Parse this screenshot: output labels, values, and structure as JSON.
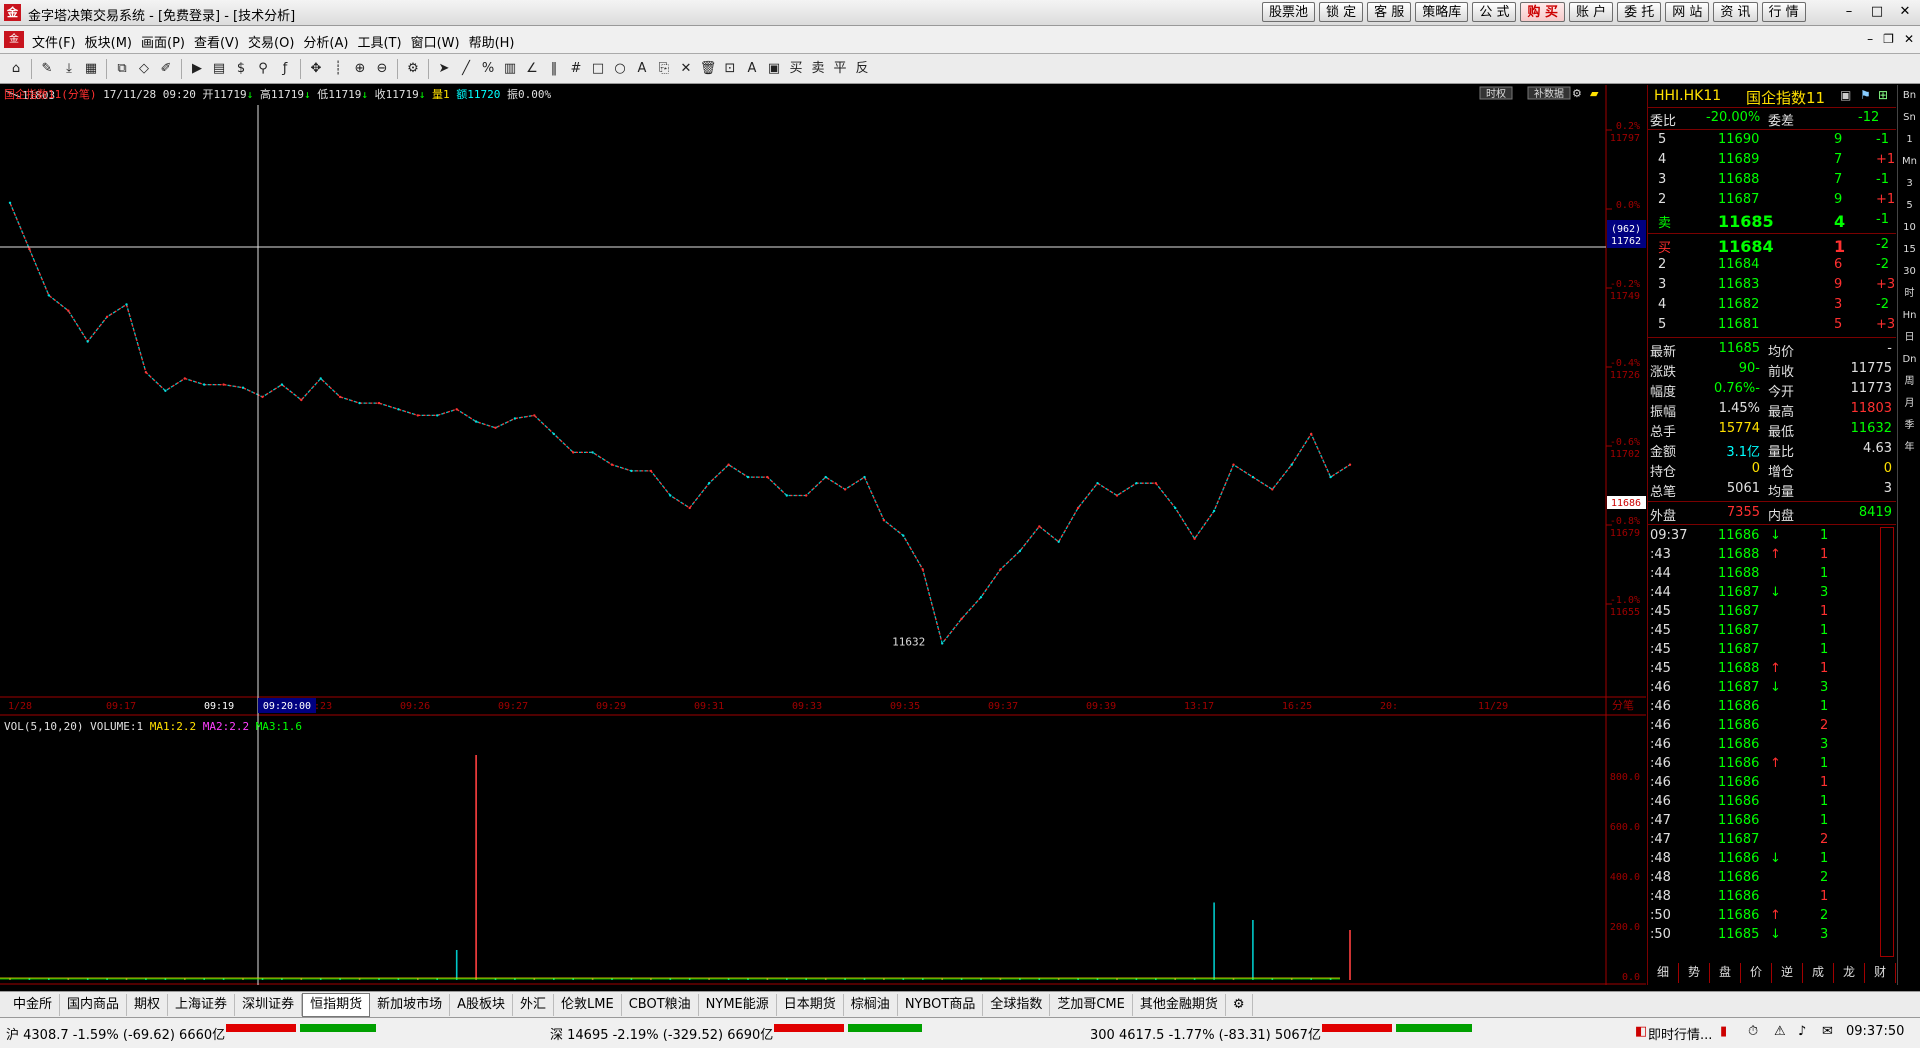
{
  "window": {
    "title": "金字塔决策交易系统 - [免费登录] - [技术分析]",
    "app_icon": "app-logo-icon"
  },
  "top_buttons": [
    {
      "label": "股票池"
    },
    {
      "label": "锁 定"
    },
    {
      "label": "客 服"
    },
    {
      "label": "策略库"
    },
    {
      "label": "公 式"
    },
    {
      "label": "购 买",
      "highlight": true
    },
    {
      "label": "账 户"
    },
    {
      "label": "委 托"
    },
    {
      "label": "网 站"
    },
    {
      "label": "资 讯"
    },
    {
      "label": "行 情"
    }
  ],
  "menu": [
    "文件(F)",
    "板块(M)",
    "画面(P)",
    "查看(V)",
    "交易(O)",
    "分析(A)",
    "工具(T)",
    "窗口(W)",
    "帮助(H)"
  ],
  "chart": {
    "info": {
      "symbol": "国企指数11(分笔)",
      "date": "17/11/28",
      "time": "09:20",
      "open": "开11719",
      "high": "高11719",
      "low": "低11719",
      "close": "收11719",
      "qty": "量1",
      "amount": "额11720",
      "amp": "振0.00%"
    },
    "badges": [
      "时权",
      "补数据"
    ],
    "max_label": "11803",
    "min_label": "11632",
    "cursor_time": "09:20:00",
    "cursor_price": "11762",
    "cursor_count": "(962)",
    "last_price_tag": "11686",
    "time_axis": [
      "1/28",
      "09:17",
      "09:19",
      "09:23",
      "09:26",
      "09:27",
      "09:29",
      "09:31",
      "09:33",
      "09:35",
      "09:37",
      "09:39",
      "13:17",
      "16:25",
      "20:",
      "11/29"
    ],
    "time_axis_right": "分笔",
    "price_ticks": [
      {
        "pct": "0.2%",
        "price": "11797"
      },
      {
        "pct": "0.0%",
        "price": ""
      },
      {
        "pct": "-0.2%",
        "price": "11749"
      },
      {
        "pct": "-0.4%",
        "price": "11726"
      },
      {
        "pct": "-0.6%",
        "price": "11702"
      },
      {
        "pct": "-0.8%",
        "price": "11679"
      },
      {
        "pct": "-1.0%",
        "price": "11655"
      }
    ],
    "volume": {
      "title": "VOL(5,10,20)",
      "label": "VOLUME:1",
      "ma1": "MA1:2.2",
      "ma2": "MA2:2.2",
      "ma3": "MA3:1.6",
      "ticks": [
        "800.0",
        "600.0",
        "400.0",
        "200.0",
        "0.0"
      ]
    }
  },
  "chart_data": {
    "type": "line",
    "title": "国企指数11(分笔)",
    "y_range": [
      11625,
      11810
    ],
    "x": [
      0,
      1,
      2,
      3,
      4,
      5,
      6,
      7,
      8,
      9,
      10,
      11,
      12,
      13,
      14,
      15,
      16,
      17,
      18,
      19,
      20,
      21,
      22,
      23,
      24,
      25,
      26,
      27,
      28,
      29,
      30,
      31,
      32,
      33,
      34,
      35,
      36,
      37,
      38,
      39,
      40,
      41,
      42,
      43,
      44,
      45,
      46,
      47,
      48,
      49,
      50,
      51,
      52,
      53,
      54,
      55,
      56,
      57,
      58,
      59,
      60,
      61,
      62,
      63,
      64,
      65,
      66,
      67,
      68,
      69
    ],
    "series": [
      {
        "name": "price",
        "values": [
          11775,
          11760,
          11745,
          11740,
          11730,
          11738,
          11742,
          11720,
          11714,
          11718,
          11716,
          11716,
          11715,
          11712,
          11716,
          11711,
          11718,
          11712,
          11710,
          11710,
          11708,
          11706,
          11706,
          11708,
          11704,
          11702,
          11705,
          11706,
          11700,
          11694,
          11694,
          11690,
          11688,
          11688,
          11680,
          11676,
          11684,
          11690,
          11686,
          11686,
          11680,
          11680,
          11686,
          11682,
          11686,
          11672,
          11667,
          11656,
          11632,
          11640,
          11647,
          11656,
          11662,
          11670,
          11665,
          11676,
          11684,
          11680,
          11684,
          11684,
          11676,
          11666,
          11675,
          11690,
          11686,
          11682,
          11690,
          11700,
          11686,
          11690
        ]
      },
      {
        "name": "volume",
        "values": [
          1,
          1,
          3,
          2,
          1,
          1,
          1,
          1,
          1,
          2,
          1,
          1,
          1,
          1,
          1,
          1,
          2,
          1,
          1,
          1,
          5,
          1,
          1,
          120,
          900,
          1,
          1,
          1,
          2,
          1,
          1,
          1,
          1,
          1,
          1,
          1,
          1,
          1,
          1,
          2,
          1,
          1,
          1,
          1,
          1,
          1,
          1,
          1,
          1,
          1,
          1,
          1,
          1,
          1,
          1,
          1,
          1,
          1,
          1,
          1,
          1,
          1,
          310,
          1,
          240,
          1,
          1,
          1,
          1,
          200
        ]
      }
    ]
  },
  "panel": {
    "code": "HHI.HK11",
    "name": "国企指数11",
    "weibi_label": "委比",
    "weibi": "-20.00%",
    "weicha_label": "委差",
    "weicha": "-12",
    "asks": [
      {
        "lvl": "5",
        "price": "11690",
        "vol": "9",
        "chg": "-1"
      },
      {
        "lvl": "4",
        "price": "11689",
        "vol": "7",
        "chg": "+1"
      },
      {
        "lvl": "3",
        "price": "11688",
        "vol": "7",
        "chg": "-1"
      },
      {
        "lvl": "2",
        "price": "11687",
        "vol": "9",
        "chg": "+1"
      },
      {
        "lvl": "卖",
        "price": "11685",
        "vol": "4",
        "chg": "-1"
      }
    ],
    "bids": [
      {
        "lvl": "买",
        "price": "11684",
        "vol": "1",
        "chg": "-2"
      },
      {
        "lvl": "2",
        "price": "11684",
        "vol": "6",
        "chg": "-2"
      },
      {
        "lvl": "3",
        "price": "11683",
        "vol": "9",
        "chg": "+3"
      },
      {
        "lvl": "4",
        "price": "11682",
        "vol": "3",
        "chg": "-2"
      },
      {
        "lvl": "5",
        "price": "11681",
        "vol": "5",
        "chg": "+3"
      }
    ],
    "stats": [
      {
        "l1": "最新",
        "v1": "11685",
        "l2": "均价",
        "v2": "-",
        "c1": "green",
        "c2": "white"
      },
      {
        "l1": "涨跌",
        "v1": "-90",
        "l2": "前收",
        "v2": "11775",
        "c1": "green",
        "c2": "white"
      },
      {
        "l1": "幅度",
        "v1": "-0.76%",
        "l2": "今开",
        "v2": "11773",
        "c1": "green",
        "c2": "white"
      },
      {
        "l1": "振幅",
        "v1": "1.45%",
        "l2": "最高",
        "v2": "11803",
        "c1": "white",
        "c2": "red"
      },
      {
        "l1": "总手",
        "v1": "15774",
        "l2": "最低",
        "v2": "11632",
        "c1": "yellow",
        "c2": "green"
      },
      {
        "l1": "金额",
        "v1": "3.1亿",
        "l2": "量比",
        "v2": "4.63",
        "c1": "cyan",
        "c2": "white"
      },
      {
        "l1": "持仓",
        "v1": "0",
        "l2": "增仓",
        "v2": "0",
        "c1": "yellow",
        "c2": "yellow"
      },
      {
        "l1": "总笔",
        "v1": "5061",
        "l2": "均量",
        "v2": "3",
        "c1": "white",
        "c2": "white"
      }
    ],
    "outer_label": "外盘",
    "outer": "7355",
    "inner_label": "内盘",
    "inner": "8419",
    "ticks": [
      {
        "t": "09:37",
        "p": "11686",
        "d": "down",
        "v": "1"
      },
      {
        "t": ":43",
        "p": "11688",
        "d": "up",
        "v": "1"
      },
      {
        "t": ":44",
        "p": "11688",
        "d": "",
        "v": "1"
      },
      {
        "t": ":44",
        "p": "11687",
        "d": "down",
        "v": "3"
      },
      {
        "t": ":45",
        "p": "11687",
        "d": "",
        "v": "1"
      },
      {
        "t": ":45",
        "p": "11687",
        "d": "",
        "v": "1"
      },
      {
        "t": ":45",
        "p": "11687",
        "d": "",
        "v": "1"
      },
      {
        "t": ":45",
        "p": "11688",
        "d": "up",
        "v": "1"
      },
      {
        "t": ":46",
        "p": "11687",
        "d": "down",
        "v": "3"
      },
      {
        "t": ":46",
        "p": "11686",
        "d": "",
        "v": "1"
      },
      {
        "t": ":46",
        "p": "11686",
        "d": "",
        "v": "2"
      },
      {
        "t": ":46",
        "p": "11686",
        "d": "",
        "v": "3"
      },
      {
        "t": ":46",
        "p": "11686",
        "d": "up",
        "v": "1"
      },
      {
        "t": ":46",
        "p": "11686",
        "d": "",
        "v": "1"
      },
      {
        "t": ":46",
        "p": "11686",
        "d": "",
        "v": "1"
      },
      {
        "t": ":47",
        "p": "11686",
        "d": "",
        "v": "1"
      },
      {
        "t": ":47",
        "p": "11687",
        "d": "",
        "v": "2"
      },
      {
        "t": ":48",
        "p": "11686",
        "d": "down",
        "v": "1"
      },
      {
        "t": ":48",
        "p": "11686",
        "d": "",
        "v": "2"
      },
      {
        "t": ":48",
        "p": "11686",
        "d": "",
        "v": "1"
      },
      {
        "t": ":50",
        "p": "11686",
        "d": "up",
        "v": "2"
      },
      {
        "t": ":50",
        "p": "11685",
        "d": "down",
        "v": "3"
      }
    ],
    "panel_tabs": [
      "细",
      "势",
      "盘",
      "价",
      "逆",
      "成",
      "龙",
      "财"
    ]
  },
  "side_strip": [
    "Bn",
    "Sn",
    "1",
    "Mn",
    "3",
    "5",
    "10",
    "15",
    "30",
    "时",
    "Hn",
    "日",
    "Dn",
    "周",
    "月",
    "季",
    "年"
  ],
  "tabs": [
    "中金所",
    "国内商品",
    "期权",
    "上海证券",
    "深圳证券",
    "恒指期货",
    "新加坡市场",
    "A股板块",
    "外汇",
    "伦敦LME",
    "CBOT粮油",
    "NYME能源",
    "日本期货",
    "棕榈油",
    "NYBOT商品",
    "全球指数",
    "芝加哥CME",
    "其他金融期货"
  ],
  "active_tab": "恒指期货",
  "status": {
    "sh": "沪 4308.7 -1.59% (-69.62) 6660亿",
    "sz": "深 14695 -2.19% (-329.52) 6690亿",
    "i300": "300 4617.5 -1.77% (-83.31) 5067亿",
    "realtime": "即时行情...",
    "clock": "09:37:50"
  }
}
